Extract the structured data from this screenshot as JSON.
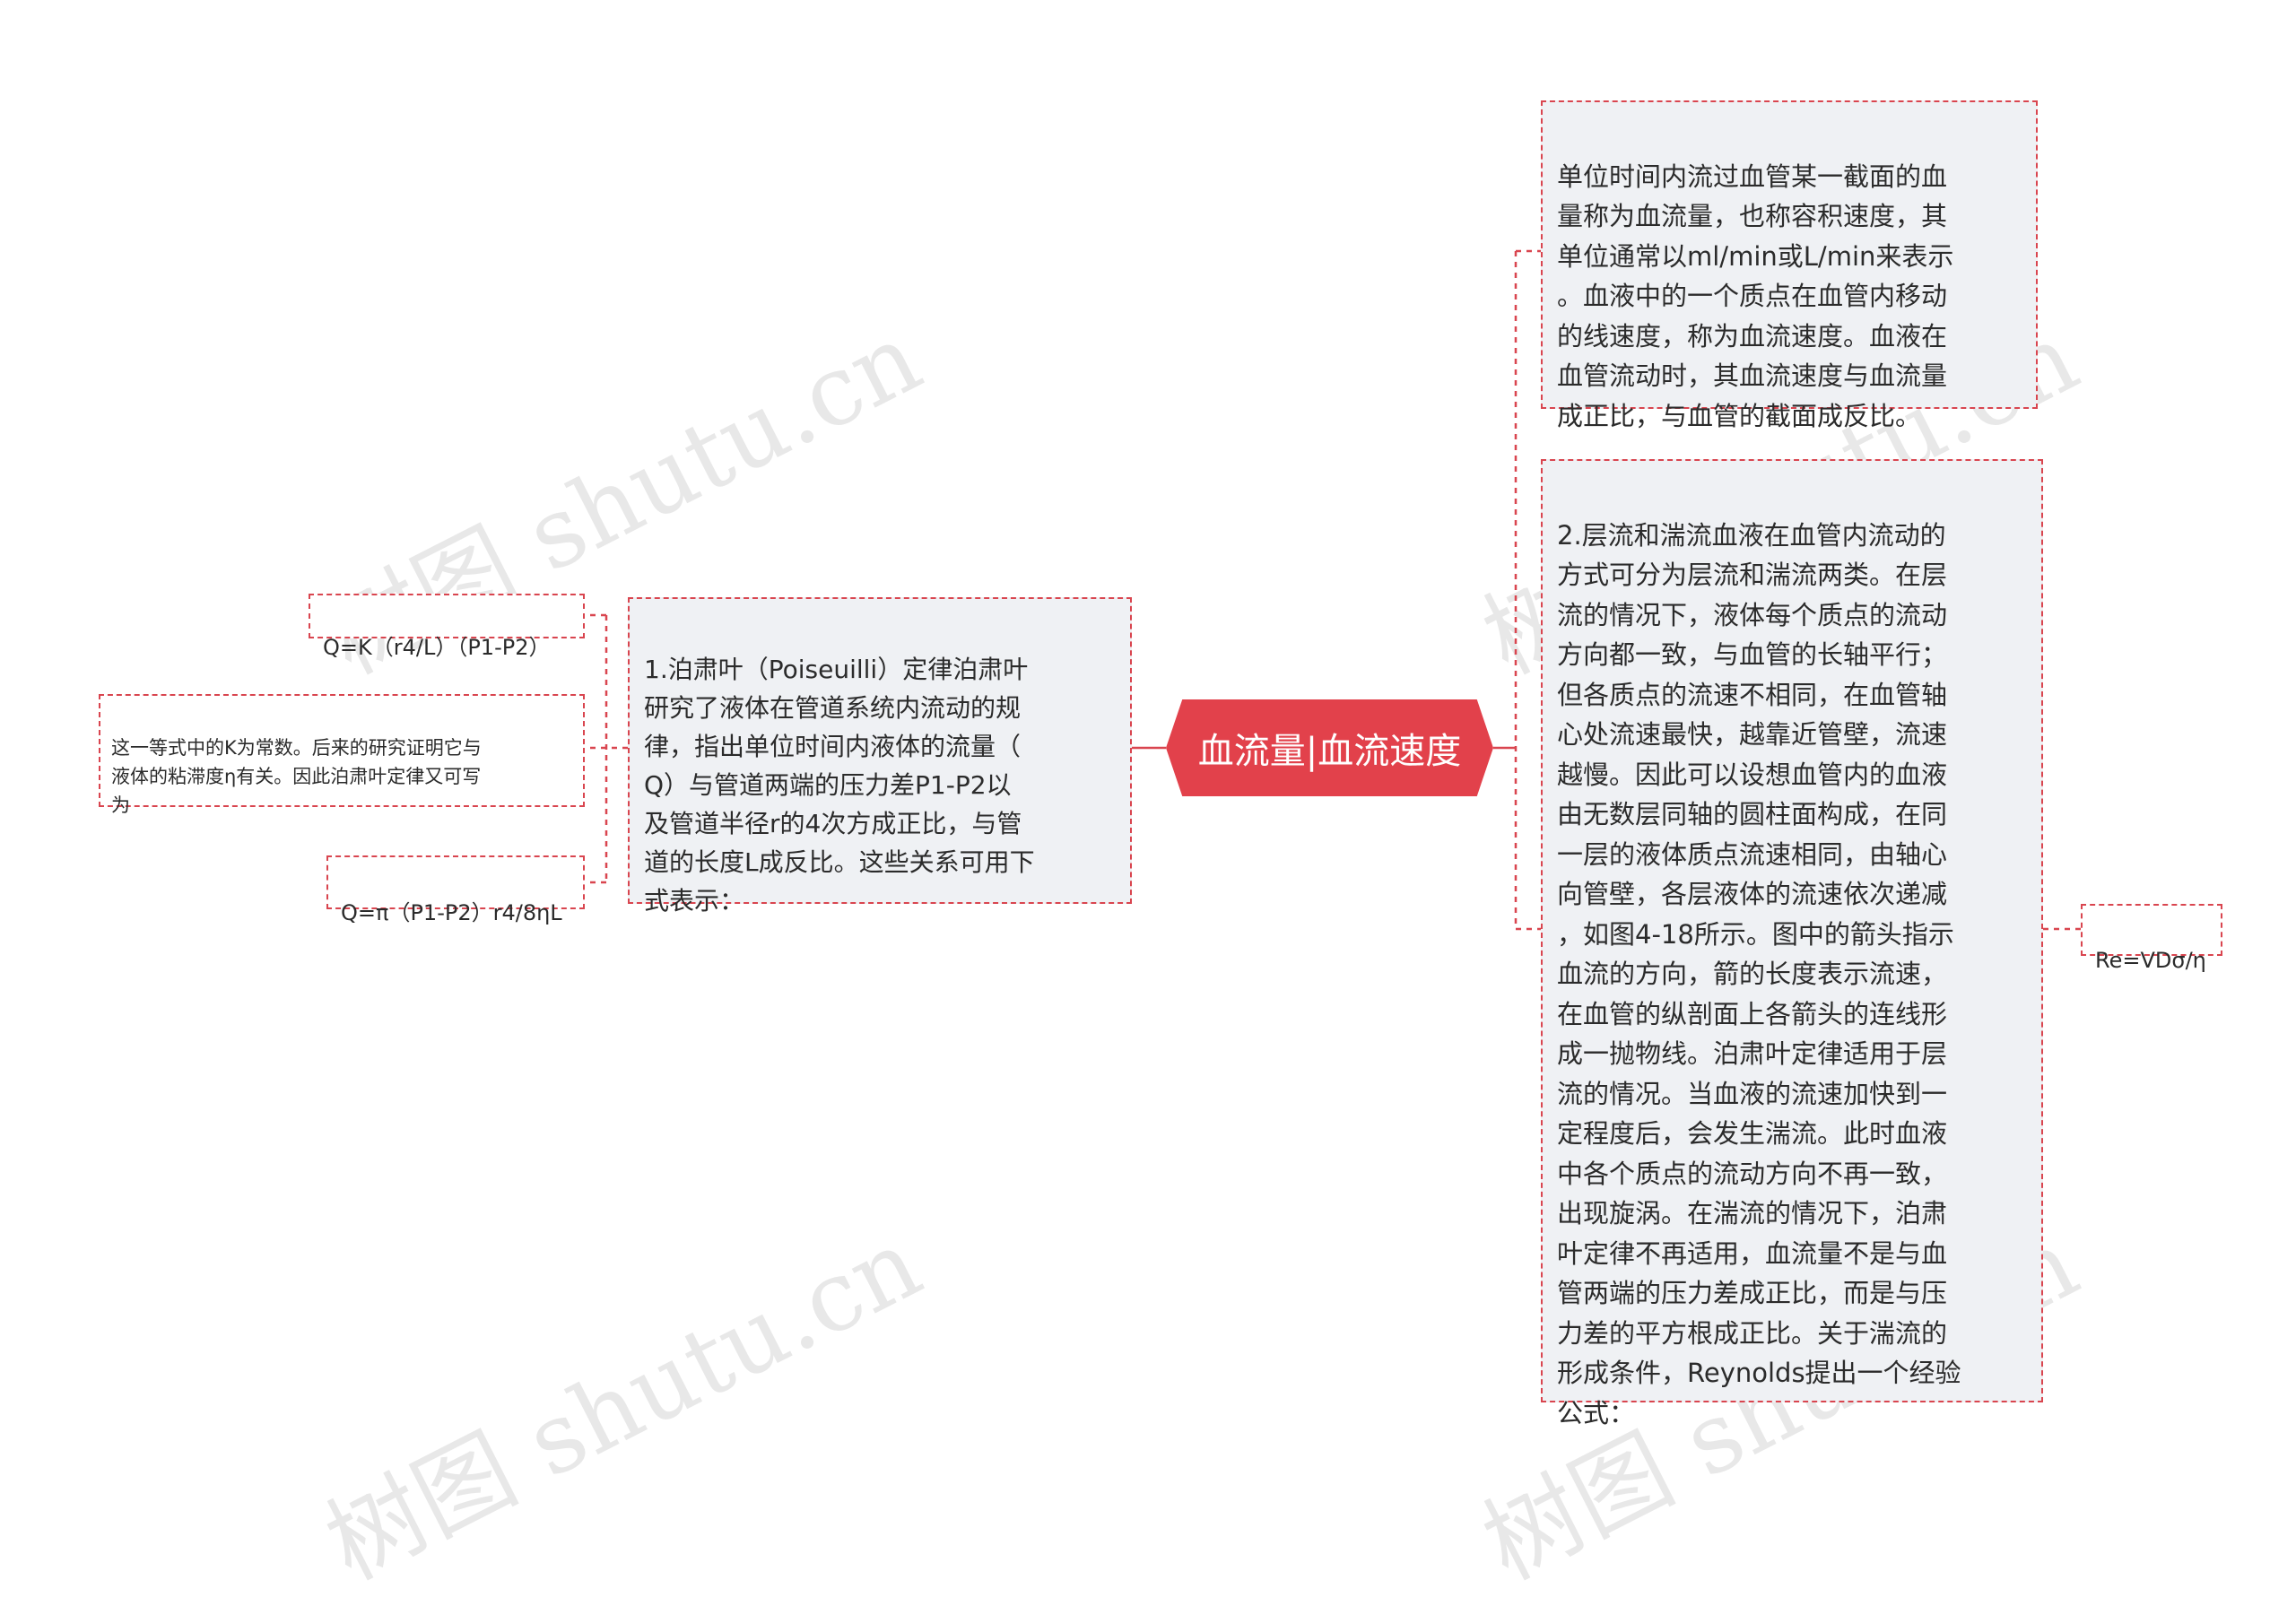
{
  "root": {
    "label": "血流量|血流速度"
  },
  "left": {
    "main": "1.泊肃叶（Poiseuilli）定律泊肃叶\n研究了液体在管道系统内流动的规\n律，指出单位时间内液体的流量（\nQ）与管道两端的压力差P1-P2以\n及管道半径r的4次方成正比，与管\n道的长度L成反比。这些关系可用下\n式表示：",
    "children": [
      "Q=K（r4/L）（P1-P2）",
      "这一等式中的K为常数。后来的研究证明它与\n液体的粘滞度η有关。因此泊肃叶定律又可写\n为",
      "Q=π（P1-P2）r4/8ηL"
    ]
  },
  "right": {
    "top": "单位时间内流过血管某一截面的血\n量称为血流量，也称容积速度，其\n单位通常以ml/min或L/min来表示\n。血液中的一个质点在血管内移动\n的线速度，称为血流速度。血液在\n血管流动时，其血流速度与血流量\n成正比，与血管的截面成反比。",
    "bottom": "2.层流和湍流血液在血管内流动的\n方式可分为层流和湍流两类。在层\n流的情况下，液体每个质点的流动\n方向都一致，与血管的长轴平行；\n但各质点的流速不相同，在血管轴\n心处流速最快，越靠近管壁，流速\n越慢。因此可以设想血管内的血液\n由无数层同轴的圆柱面构成，在同\n一层的液体质点流速相同，由轴心\n向管壁，各层液体的流速依次递减\n，如图4-18所示。图中的箭头指示\n血流的方向，箭的长度表示流速，\n在血管的纵剖面上各箭头的连线形\n成一抛物线。泊肃叶定律适用于层\n流的情况。当血液的流速加快到一\n定程度后，会发生湍流。此时血液\n中各个质点的流动方向不再一致，\n出现旋涡。在湍流的情况下，泊肃\n叶定律不再适用，血流量不是与血\n管两端的压力差成正比，而是与压\n力差的平方根成正比。关于湍流的\n形成条件，Reynolds提出一个经验\n公式：",
    "formula": "Re=VDσ/η"
  },
  "watermark": "树图 shutu.cn",
  "colors": {
    "accent": "#e2414b",
    "node_bg": "#eff1f4",
    "line": "#d9454f"
  }
}
